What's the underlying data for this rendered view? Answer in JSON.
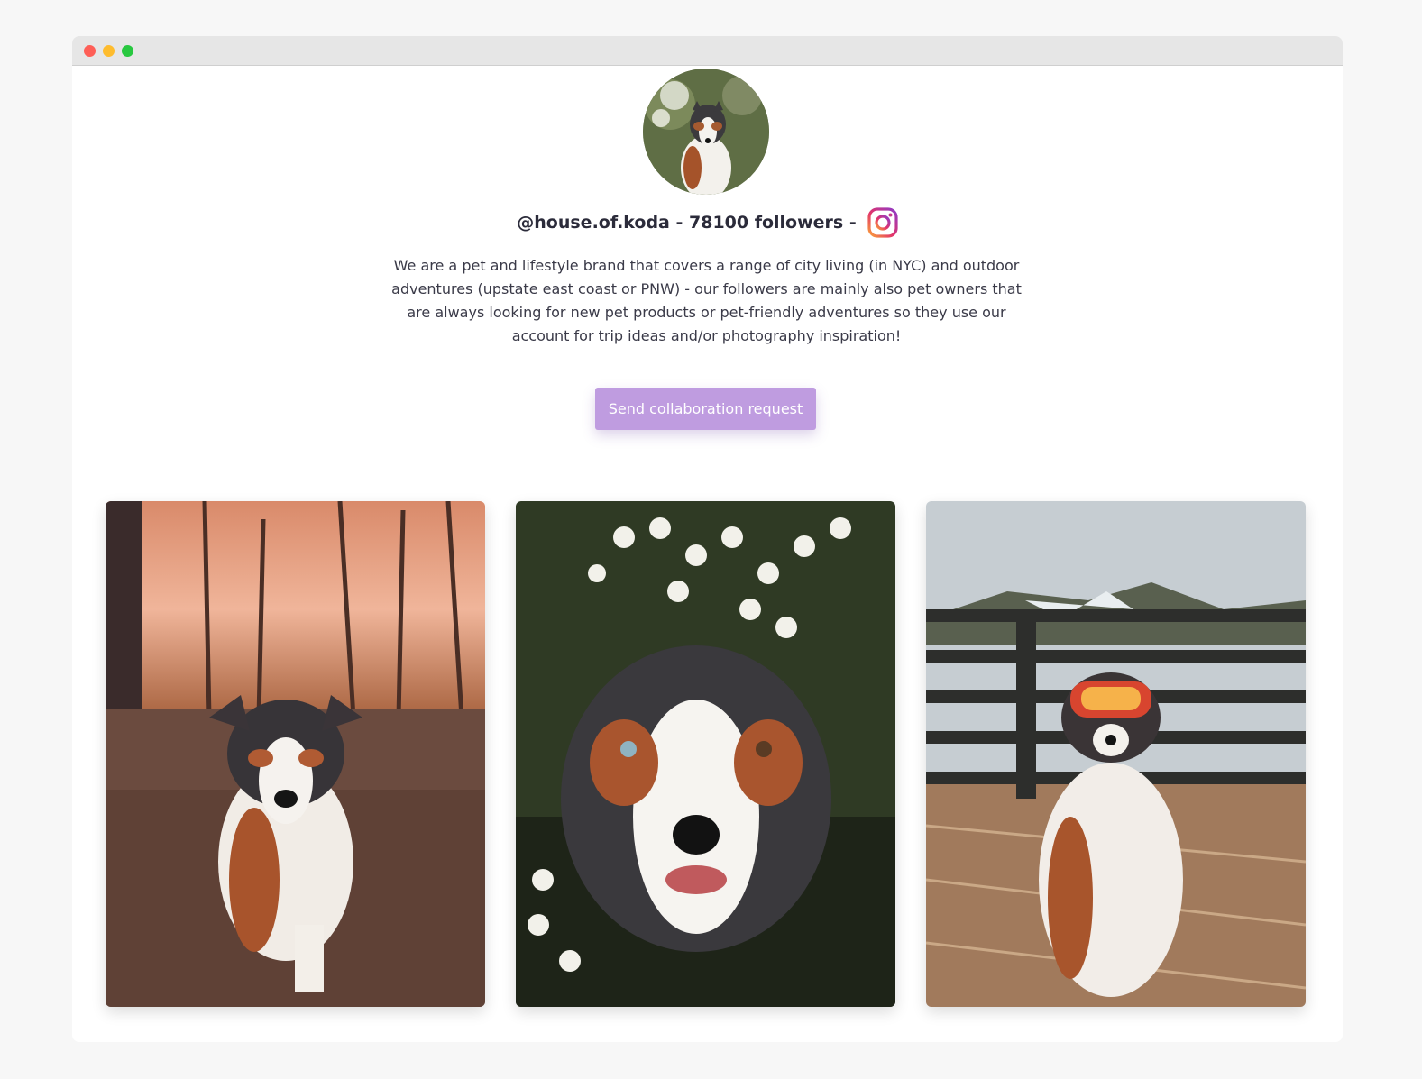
{
  "window": {
    "controls": [
      "close",
      "minimize",
      "maximize"
    ]
  },
  "profile": {
    "avatar_icon": "dog-avatar-icon",
    "handle_text": "@house.of.koda - 78100 followers -",
    "platform_icon": "instagram-icon",
    "bio": "We are a pet and lifestyle brand that covers a range of city living (in NYC) and outdoor adventures (upstate east coast or PNW) - our followers are mainly also pet owners that are always looking for new pet products or pet-friendly adventures so they use our account for trip ideas and/or photography inspiration!"
  },
  "cta": {
    "label": "Send collaboration request"
  },
  "gallery": {
    "photos": [
      {
        "icon": "dog-sunset-photo"
      },
      {
        "icon": "dog-flowers-photo"
      },
      {
        "icon": "dog-goggles-deck-photo"
      }
    ]
  },
  "colors": {
    "accent": "#bf9ce0",
    "text": "#2b2b3a",
    "page_bg": "#f7f7f7"
  }
}
